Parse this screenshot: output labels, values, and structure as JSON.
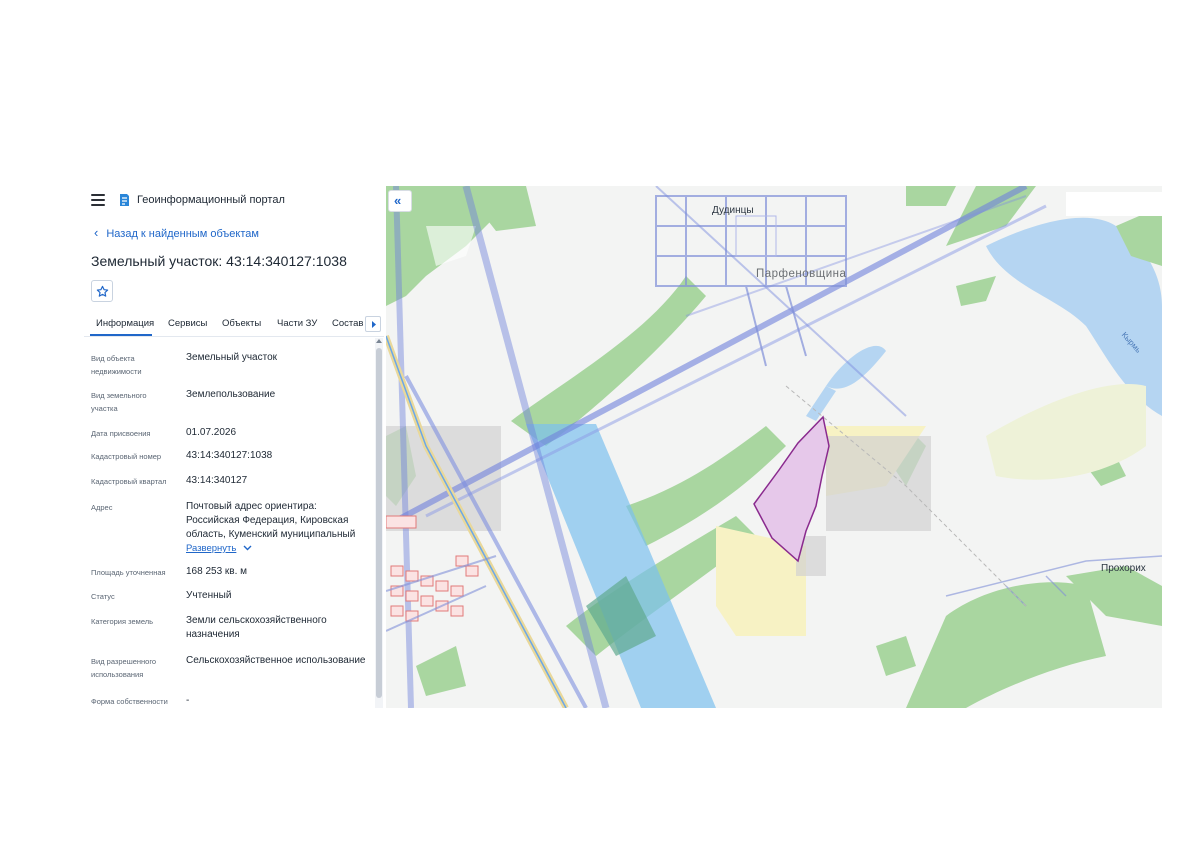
{
  "header": {
    "menu_icon": "hamburger-icon",
    "logo_icon": "portal-logo-icon",
    "portal_title": "Геоинформационный портал"
  },
  "nav": {
    "back_label": "Назад к найденным объектам",
    "back_icon": "chevron-left-icon"
  },
  "object": {
    "title": "Земельный участок: 43:14:340127:1038",
    "favorite_icon": "star-icon"
  },
  "tabs": {
    "items": [
      "Информация",
      "Сервисы",
      "Объекты",
      "Части ЗУ",
      "Состав"
    ],
    "active": "Информация",
    "more_icon": "chevron-right-icon"
  },
  "properties": [
    {
      "label": "Вид объекта недвижимости",
      "value": "Земельный участок"
    },
    {
      "label": "Вид земельного участка",
      "value": "Землепользование"
    },
    {
      "label": "Дата присвоения",
      "value": "01.07.2026"
    },
    {
      "label": "Кадастровый номер",
      "value": "43:14:340127:1038"
    },
    {
      "label": "Кадастровый квартал",
      "value": "43:14:340127"
    },
    {
      "label": "Адрес",
      "value": "Почтовый адрес ориентира: Российская Федерация, Кировская область, Куменский муниципальный",
      "expand_label": "Развернуть",
      "expand_icon": "chevron-down-icon"
    },
    {
      "label": "Площадь уточненная",
      "value": "168 253 кв. м"
    },
    {
      "label": "Статус",
      "value": "Учтенный"
    },
    {
      "label": "Категория земель",
      "value": "Земли сельскохозяйственного назначения"
    },
    {
      "label": "Вид разрешенного использования",
      "value": "Сельскохозяйственное использование"
    },
    {
      "label": "Форма собственности",
      "value": "-"
    }
  ],
  "map": {
    "collapse_icon": "double-chevron-left-icon",
    "places": {
      "dudintsy": "Дудинцы",
      "parfenovshchina": "Парфеновщина",
      "prokhorikh": "Прохорих",
      "river": "Кырмь"
    },
    "colors": {
      "forest": "#a9d6a0",
      "water": "#b5d5f2",
      "parcel_fill": "#e6c8ea",
      "parcel_stroke": "#8a2a8e",
      "field": "#f7f2c4",
      "grey_zone": "#d2d2d2",
      "power_line": "#7f8fe0",
      "zone_blue": "#7cc0ee"
    }
  }
}
